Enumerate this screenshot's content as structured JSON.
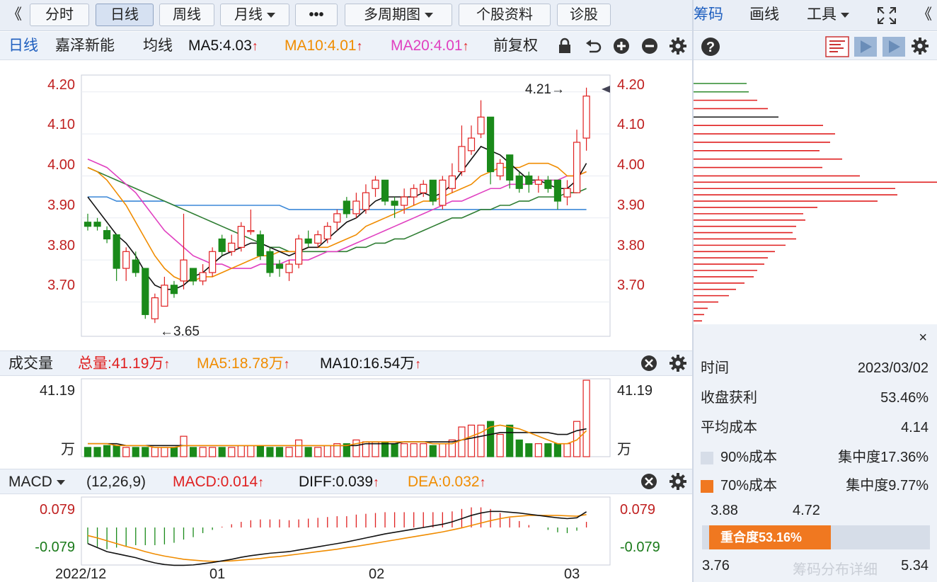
{
  "toolbar": {
    "back_left": "《",
    "tabs": [
      "分时",
      "日线",
      "周线",
      "月线",
      "•••",
      "多周期图",
      "个股资料",
      "诊股"
    ],
    "right_links": [
      "筹码",
      "画线",
      "工具"
    ],
    "collapse": "《"
  },
  "infobar": {
    "period": "日线",
    "stock_name": "嘉泽新能",
    "ma_label": "均线",
    "ma5": "MA5:4.03",
    "ma10": "MA10:4.01",
    "ma20": "MA20:4.01",
    "adjust": "前复权",
    "up_arrow": "↑"
  },
  "price_axis": [
    "4.20",
    "4.10",
    "4.00",
    "3.90",
    "3.80",
    "3.70"
  ],
  "annotations": {
    "high": "4.21→",
    "low": "←3.65"
  },
  "volume_bar": {
    "title": "成交量",
    "total": "总量:41.19万",
    "ma5": "MA5:18.78万",
    "ma10": "MA10:16.54万"
  },
  "volume_axis": {
    "top": "41.19",
    "unit": "万"
  },
  "macd_bar": {
    "title": "MACD",
    "params": "(12,26,9)",
    "macd": "MACD:0.014",
    "diff": "DIFF:0.039",
    "dea": "DEA:0.032"
  },
  "macd_axis": {
    "top": "0.079",
    "bottom": "-0.079"
  },
  "date_axis": [
    "2022/12",
    "01",
    "02",
    "03"
  ],
  "chip": {
    "time_label": "时间",
    "time_value": "2023/03/02",
    "profit_label": "收盘获利",
    "profit_value": "53.46%",
    "avg_label": "平均成本",
    "avg_value": "4.14",
    "c90_label": "90%成本",
    "c90_value": "集中度17.36%",
    "c70_label": "70%成本",
    "c70_value": "集中度9.77%",
    "range_low": "3.88",
    "range_high": "4.72",
    "overlap": "重合度53.16%",
    "min_label": "3.76",
    "max_label": "5.34",
    "watermark": "筹码分布详细",
    "close": "×"
  },
  "colors": {
    "up": "#e02020",
    "down": "#1a8a1a",
    "ma5": "#111111",
    "ma10": "#f08c00",
    "ma20": "#e040c0",
    "ma60": "#2e7d32",
    "ma120": "#3b88d8"
  },
  "chart_data": {
    "type": "candlestick",
    "x": [
      "2022/12",
      "01",
      "02",
      "03"
    ],
    "ylim": [
      3.62,
      4.24
    ],
    "candles": [
      {
        "o": 3.89,
        "c": 3.88,
        "h": 3.91,
        "l": 3.87
      },
      {
        "o": 3.89,
        "c": 3.88,
        "h": 3.9,
        "l": 3.87
      },
      {
        "o": 3.87,
        "c": 3.85,
        "h": 3.88,
        "l": 3.84
      },
      {
        "o": 3.86,
        "c": 3.78,
        "h": 3.86,
        "l": 3.75
      },
      {
        "o": 3.78,
        "c": 3.82,
        "h": 3.83,
        "l": 3.75
      },
      {
        "o": 3.8,
        "c": 3.77,
        "h": 3.82,
        "l": 3.76
      },
      {
        "o": 3.78,
        "c": 3.67,
        "h": 3.78,
        "l": 3.66
      },
      {
        "o": 3.66,
        "c": 3.71,
        "h": 3.72,
        "l": 3.65
      },
      {
        "o": 3.69,
        "c": 3.74,
        "h": 3.76,
        "l": 3.69
      },
      {
        "o": 3.74,
        "c": 3.72,
        "h": 3.75,
        "l": 3.71
      },
      {
        "o": 3.75,
        "c": 3.8,
        "h": 3.91,
        "l": 3.73
      },
      {
        "o": 3.78,
        "c": 3.75,
        "h": 3.78,
        "l": 3.74
      },
      {
        "o": 3.75,
        "c": 3.77,
        "h": 3.79,
        "l": 3.74
      },
      {
        "o": 3.77,
        "c": 3.82,
        "h": 3.83,
        "l": 3.76
      },
      {
        "o": 3.85,
        "c": 3.82,
        "h": 3.86,
        "l": 3.81
      },
      {
        "o": 3.82,
        "c": 3.84,
        "h": 3.86,
        "l": 3.81
      },
      {
        "o": 3.83,
        "c": 3.88,
        "h": 3.89,
        "l": 3.82
      },
      {
        "o": 3.87,
        "c": 3.87,
        "h": 3.92,
        "l": 3.86
      },
      {
        "o": 3.86,
        "c": 3.81,
        "h": 3.87,
        "l": 3.8
      },
      {
        "o": 3.82,
        "c": 3.77,
        "h": 3.83,
        "l": 3.76
      },
      {
        "o": 3.79,
        "c": 3.78,
        "h": 3.8,
        "l": 3.76
      },
      {
        "o": 3.77,
        "c": 3.79,
        "h": 3.8,
        "l": 3.75
      },
      {
        "o": 3.79,
        "c": 3.85,
        "h": 3.86,
        "l": 3.78
      },
      {
        "o": 3.85,
        "c": 3.84,
        "h": 3.87,
        "l": 3.83
      },
      {
        "o": 3.84,
        "c": 3.86,
        "h": 3.87,
        "l": 3.83
      },
      {
        "o": 3.85,
        "c": 3.88,
        "h": 3.89,
        "l": 3.84
      },
      {
        "o": 3.89,
        "c": 3.91,
        "h": 3.92,
        "l": 3.87
      },
      {
        "o": 3.94,
        "c": 3.91,
        "h": 3.95,
        "l": 3.9
      },
      {
        "o": 3.91,
        "c": 3.94,
        "h": 3.96,
        "l": 3.9
      },
      {
        "o": 3.92,
        "c": 3.96,
        "h": 3.98,
        "l": 3.91
      },
      {
        "o": 3.97,
        "c": 3.99,
        "h": 4.0,
        "l": 3.95
      },
      {
        "o": 3.99,
        "c": 3.94,
        "h": 3.99,
        "l": 3.93
      },
      {
        "o": 3.94,
        "c": 3.93,
        "h": 3.95,
        "l": 3.9
      },
      {
        "o": 3.93,
        "c": 3.95,
        "h": 3.97,
        "l": 3.91
      },
      {
        "o": 3.95,
        "c": 3.97,
        "h": 3.98,
        "l": 3.93
      },
      {
        "o": 3.96,
        "c": 3.98,
        "h": 3.99,
        "l": 3.95
      },
      {
        "o": 3.99,
        "c": 3.94,
        "h": 3.99,
        "l": 3.93
      },
      {
        "o": 3.93,
        "c": 3.99,
        "h": 4.0,
        "l": 3.92
      },
      {
        "o": 3.97,
        "c": 4.0,
        "h": 4.03,
        "l": 3.96
      },
      {
        "o": 4.01,
        "c": 4.07,
        "h": 4.12,
        "l": 4.0
      },
      {
        "o": 4.06,
        "c": 4.09,
        "h": 4.12,
        "l": 4.05
      },
      {
        "o": 4.1,
        "c": 4.14,
        "h": 4.18,
        "l": 4.09
      },
      {
        "o": 4.14,
        "c": 4.01,
        "h": 4.14,
        "l": 3.98
      },
      {
        "o": 4.0,
        "c": 4.03,
        "h": 4.04,
        "l": 3.99
      },
      {
        "o": 4.05,
        "c": 3.99,
        "h": 4.05,
        "l": 3.97
      },
      {
        "o": 4.0,
        "c": 3.97,
        "h": 4.01,
        "l": 3.96
      },
      {
        "o": 4.0,
        "c": 3.98,
        "h": 4.01,
        "l": 3.96
      },
      {
        "o": 3.98,
        "c": 3.99,
        "h": 4.0,
        "l": 3.96
      },
      {
        "o": 3.99,
        "c": 3.97,
        "h": 4.0,
        "l": 3.96
      },
      {
        "o": 3.99,
        "c": 3.94,
        "h": 3.99,
        "l": 3.92
      },
      {
        "o": 3.95,
        "c": 3.97,
        "h": 3.99,
        "l": 3.93
      },
      {
        "o": 3.96,
        "c": 4.08,
        "h": 4.11,
        "l": 3.96
      },
      {
        "o": 4.09,
        "c": 4.19,
        "h": 4.21,
        "l": 4.06
      }
    ],
    "ma5": [
      3.95,
      3.92,
      3.89,
      3.86,
      3.84,
      3.81,
      3.77,
      3.74,
      3.73,
      3.73,
      3.74,
      3.76,
      3.77,
      3.79,
      3.81,
      3.82,
      3.83,
      3.84,
      3.84,
      3.83,
      3.82,
      3.81,
      3.82,
      3.83,
      3.83,
      3.85,
      3.87,
      3.89,
      3.9,
      3.92,
      3.94,
      3.95,
      3.95,
      3.95,
      3.95,
      3.96,
      3.95,
      3.96,
      3.98,
      4.01,
      4.04,
      4.07,
      4.06,
      4.05,
      4.03,
      4.01,
      3.99,
      3.99,
      3.98,
      3.97,
      3.97,
      3.99,
      4.03
    ],
    "ma10": [
      4.02,
      4.01,
      3.99,
      3.96,
      3.93,
      3.89,
      3.85,
      3.81,
      3.78,
      3.76,
      3.75,
      3.75,
      3.76,
      3.76,
      3.77,
      3.78,
      3.79,
      3.8,
      3.81,
      3.81,
      3.82,
      3.82,
      3.82,
      3.83,
      3.83,
      3.83,
      3.84,
      3.85,
      3.86,
      3.88,
      3.89,
      3.9,
      3.91,
      3.92,
      3.93,
      3.94,
      3.94,
      3.95,
      3.96,
      3.97,
      3.98,
      4.0,
      4.01,
      4.02,
      4.02,
      4.02,
      4.03,
      4.03,
      4.03,
      4.02,
      4.0,
      4.0,
      4.01
    ],
    "ma20": [
      4.04,
      4.03,
      4.02,
      4.0,
      3.98,
      3.96,
      3.93,
      3.9,
      3.87,
      3.85,
      3.83,
      3.81,
      3.8,
      3.79,
      3.79,
      3.78,
      3.78,
      3.78,
      3.79,
      3.79,
      3.79,
      3.8,
      3.8,
      3.8,
      3.81,
      3.82,
      3.82,
      3.83,
      3.84,
      3.85,
      3.86,
      3.87,
      3.88,
      3.89,
      3.9,
      3.91,
      3.92,
      3.93,
      3.94,
      3.94,
      3.95,
      3.96,
      3.97,
      3.97,
      3.98,
      3.98,
      3.98,
      3.99,
      3.99,
      3.99,
      4.0,
      4.0,
      4.01
    ],
    "ma60": [
      4.02,
      4.01,
      4.0,
      3.99,
      3.98,
      3.97,
      3.96,
      3.95,
      3.94,
      3.93,
      3.92,
      3.91,
      3.9,
      3.89,
      3.88,
      3.87,
      3.86,
      3.85,
      3.84,
      3.83,
      3.83,
      3.82,
      3.82,
      3.82,
      3.82,
      3.82,
      3.82,
      3.82,
      3.83,
      3.83,
      3.84,
      3.84,
      3.85,
      3.85,
      3.86,
      3.87,
      3.88,
      3.89,
      3.9,
      3.9,
      3.91,
      3.92,
      3.92,
      3.93,
      3.93,
      3.94,
      3.94,
      3.95,
      3.95,
      3.95,
      3.96,
      3.96,
      3.97
    ],
    "ma120": [
      3.95,
      3.95,
      3.95,
      3.94,
      3.94,
      3.94,
      3.94,
      3.94,
      3.94,
      3.93,
      3.93,
      3.93,
      3.93,
      3.93,
      3.93,
      3.93,
      3.93,
      3.93,
      3.93,
      3.93,
      3.93,
      3.92,
      3.92,
      3.92,
      3.92,
      3.92,
      3.92,
      3.92,
      3.92,
      3.92,
      3.92,
      3.92,
      3.92,
      3.92,
      3.92,
      3.92,
      3.92,
      3.92,
      3.92,
      3.92,
      3.92,
      3.92,
      3.92,
      3.92,
      3.92,
      3.92,
      3.92,
      3.92,
      3.92,
      3.92,
      3.92,
      3.92,
      3.92
    ],
    "volume": [
      5,
      5,
      6,
      6,
      5,
      5,
      5,
      5,
      5,
      5,
      11,
      5,
      5,
      5,
      5,
      5,
      6,
      6,
      6,
      5,
      5,
      5,
      9,
      5,
      5,
      6,
      7,
      7,
      9,
      8,
      8,
      8,
      7,
      7,
      7,
      7,
      6,
      7,
      9,
      16,
      17,
      17,
      19,
      12,
      17,
      9,
      7,
      7,
      7,
      7,
      7,
      19,
      41.19
    ],
    "volume_ma5": [
      7,
      7,
      7,
      6,
      6,
      6,
      6,
      5,
      5,
      5,
      6,
      6,
      6,
      6,
      6,
      6,
      6,
      6,
      6,
      6,
      6,
      6,
      6,
      6,
      6,
      6,
      6,
      6,
      7,
      8,
      8,
      8,
      8,
      8,
      8,
      8,
      7,
      7,
      7,
      9,
      11,
      13,
      16,
      17,
      16,
      15,
      13,
      11,
      9,
      7,
      7,
      9,
      14
    ],
    "volume_ma10": [
      7,
      7,
      7,
      7,
      6,
      6,
      6,
      6,
      6,
      6,
      6,
      6,
      6,
      6,
      6,
      6,
      6,
      6,
      6,
      6,
      6,
      6,
      6,
      6,
      6,
      6,
      6,
      6,
      6,
      7,
      7,
      7,
      7,
      8,
      8,
      8,
      8,
      8,
      8,
      9,
      10,
      11,
      12,
      13,
      13,
      13,
      13,
      13,
      13,
      12,
      12,
      14,
      15
    ],
    "macd_diff": [
      -0.04,
      -0.05,
      -0.06,
      -0.065,
      -0.07,
      -0.075,
      -0.082,
      -0.088,
      -0.092,
      -0.094,
      -0.094,
      -0.093,
      -0.09,
      -0.087,
      -0.083,
      -0.079,
      -0.074,
      -0.07,
      -0.067,
      -0.064,
      -0.062,
      -0.06,
      -0.056,
      -0.052,
      -0.048,
      -0.044,
      -0.04,
      -0.036,
      -0.031,
      -0.026,
      -0.021,
      -0.016,
      -0.012,
      -0.008,
      -0.004,
      0.0,
      0.004,
      0.008,
      0.014,
      0.022,
      0.03,
      0.036,
      0.04,
      0.04,
      0.038,
      0.036,
      0.033,
      0.03,
      0.027,
      0.024,
      0.022,
      0.024,
      0.039
    ],
    "macd_dea": [
      -0.02,
      -0.026,
      -0.033,
      -0.04,
      -0.047,
      -0.053,
      -0.06,
      -0.066,
      -0.071,
      -0.075,
      -0.079,
      -0.081,
      -0.083,
      -0.084,
      -0.084,
      -0.083,
      -0.081,
      -0.079,
      -0.077,
      -0.074,
      -0.072,
      -0.069,
      -0.066,
      -0.063,
      -0.06,
      -0.057,
      -0.054,
      -0.05,
      -0.047,
      -0.043,
      -0.039,
      -0.035,
      -0.031,
      -0.027,
      -0.023,
      -0.019,
      -0.015,
      -0.011,
      -0.006,
      -0.001,
      0.005,
      0.011,
      0.017,
      0.022,
      0.026,
      0.028,
      0.03,
      0.03,
      0.03,
      0.03,
      0.029,
      0.028,
      0.032
    ],
    "chip_distribution": [
      {
        "price": 4.22,
        "len": 75,
        "color": "#2e8b2e"
      },
      {
        "price": 4.2,
        "len": 78,
        "color": "#2e8b2e"
      },
      {
        "price": 4.18,
        "len": 90,
        "color": "#e02020"
      },
      {
        "price": 4.16,
        "len": 105,
        "color": "#e02020"
      },
      {
        "price": 4.14,
        "len": 120,
        "color": "#222222"
      },
      {
        "price": 4.12,
        "len": 183,
        "color": "#e02020"
      },
      {
        "price": 4.1,
        "len": 200,
        "color": "#e02020"
      },
      {
        "price": 4.08,
        "len": 193,
        "color": "#e02020"
      },
      {
        "price": 4.06,
        "len": 178,
        "color": "#e02020"
      },
      {
        "price": 4.04,
        "len": 210,
        "color": "#e02020"
      },
      {
        "price": 4.02,
        "len": 182,
        "color": "#e02020"
      },
      {
        "price": 4.0,
        "len": 235,
        "color": "#e02020"
      },
      {
        "price": 3.985,
        "len": 344,
        "color": "#e02020"
      },
      {
        "price": 3.97,
        "len": 285,
        "color": "#e02020"
      },
      {
        "price": 3.955,
        "len": 288,
        "color": "#e02020"
      },
      {
        "price": 3.94,
        "len": 260,
        "color": "#e02020"
      },
      {
        "price": 3.925,
        "len": 175,
        "color": "#e02020"
      },
      {
        "price": 3.91,
        "len": 155,
        "color": "#e02020"
      },
      {
        "price": 3.895,
        "len": 158,
        "color": "#e02020"
      },
      {
        "price": 3.88,
        "len": 145,
        "color": "#e02020"
      },
      {
        "price": 3.865,
        "len": 140,
        "color": "#e02020"
      },
      {
        "price": 3.85,
        "len": 145,
        "color": "#e02020"
      },
      {
        "price": 3.835,
        "len": 130,
        "color": "#e02020"
      },
      {
        "price": 3.82,
        "len": 115,
        "color": "#e02020"
      },
      {
        "price": 3.805,
        "len": 105,
        "color": "#e02020"
      },
      {
        "price": 3.79,
        "len": 100,
        "color": "#e02020"
      },
      {
        "price": 3.775,
        "len": 90,
        "color": "#e02020"
      },
      {
        "price": 3.76,
        "len": 85,
        "color": "#e02020"
      },
      {
        "price": 3.745,
        "len": 72,
        "color": "#e02020"
      },
      {
        "price": 3.73,
        "len": 60,
        "color": "#e02020"
      },
      {
        "price": 3.715,
        "len": 50,
        "color": "#e02020"
      },
      {
        "price": 3.7,
        "len": 35,
        "color": "#e02020"
      },
      {
        "price": 3.685,
        "len": 20,
        "color": "#e02020"
      },
      {
        "price": 3.67,
        "len": 15,
        "color": "#e02020"
      },
      {
        "price": 3.655,
        "len": 12,
        "color": "#e02020"
      }
    ]
  }
}
